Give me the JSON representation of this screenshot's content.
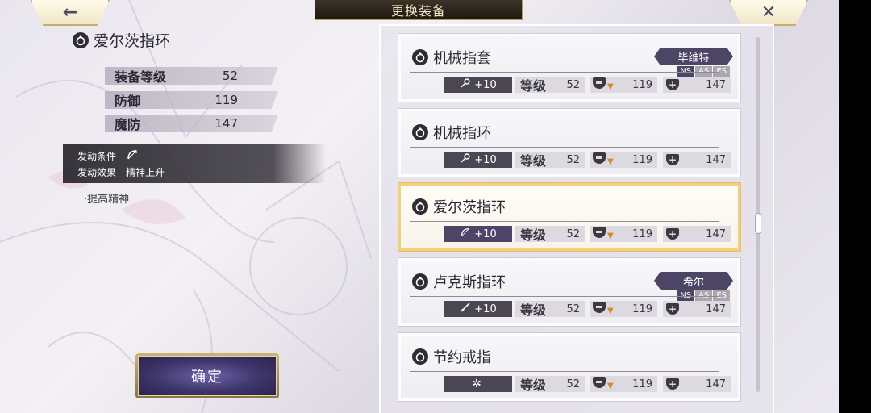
{
  "header": {
    "title": "更换装备",
    "back_icon": "←",
    "close_icon": "✕"
  },
  "selected": {
    "name": "爱尔茨指环",
    "stats": [
      {
        "label": "装备等级",
        "value": "52"
      },
      {
        "label": "防御",
        "value": "119"
      },
      {
        "label": "魔防",
        "value": "147"
      }
    ],
    "trigger_label": "发动条件",
    "effect_label": "发动效果",
    "effect_value": "精神上升",
    "note": "·提高精神",
    "confirm_label": "确定"
  },
  "items": [
    {
      "name": "机械指套",
      "bonus": "+10",
      "bonus_icon": "key-icon",
      "level_label": "等级",
      "level": "52",
      "def": "119",
      "mdef": "147",
      "owner": "毕维特",
      "versions": [
        "NS",
        "AS",
        "ES"
      ]
    },
    {
      "name": "机械指环",
      "bonus": "+10",
      "bonus_icon": "key-icon",
      "level_label": "等级",
      "level": "52",
      "def": "119",
      "mdef": "147"
    },
    {
      "name": "爱尔茨指环",
      "bonus": "+10",
      "bonus_icon": "bow-icon",
      "level_label": "等级",
      "level": "52",
      "def": "119",
      "mdef": "147",
      "selected": true
    },
    {
      "name": "卢克斯指环",
      "bonus": "+10",
      "bonus_icon": "sword-icon",
      "level_label": "等级",
      "level": "52",
      "def": "119",
      "mdef": "147",
      "owner": "希尔",
      "versions": [
        "NS",
        "AS",
        "ES"
      ]
    },
    {
      "name": "节约戒指",
      "bonus": "",
      "bonus_icon": "sparkle-icon",
      "level_label": "等级",
      "level": "52",
      "def": "119",
      "mdef": "147"
    }
  ]
}
